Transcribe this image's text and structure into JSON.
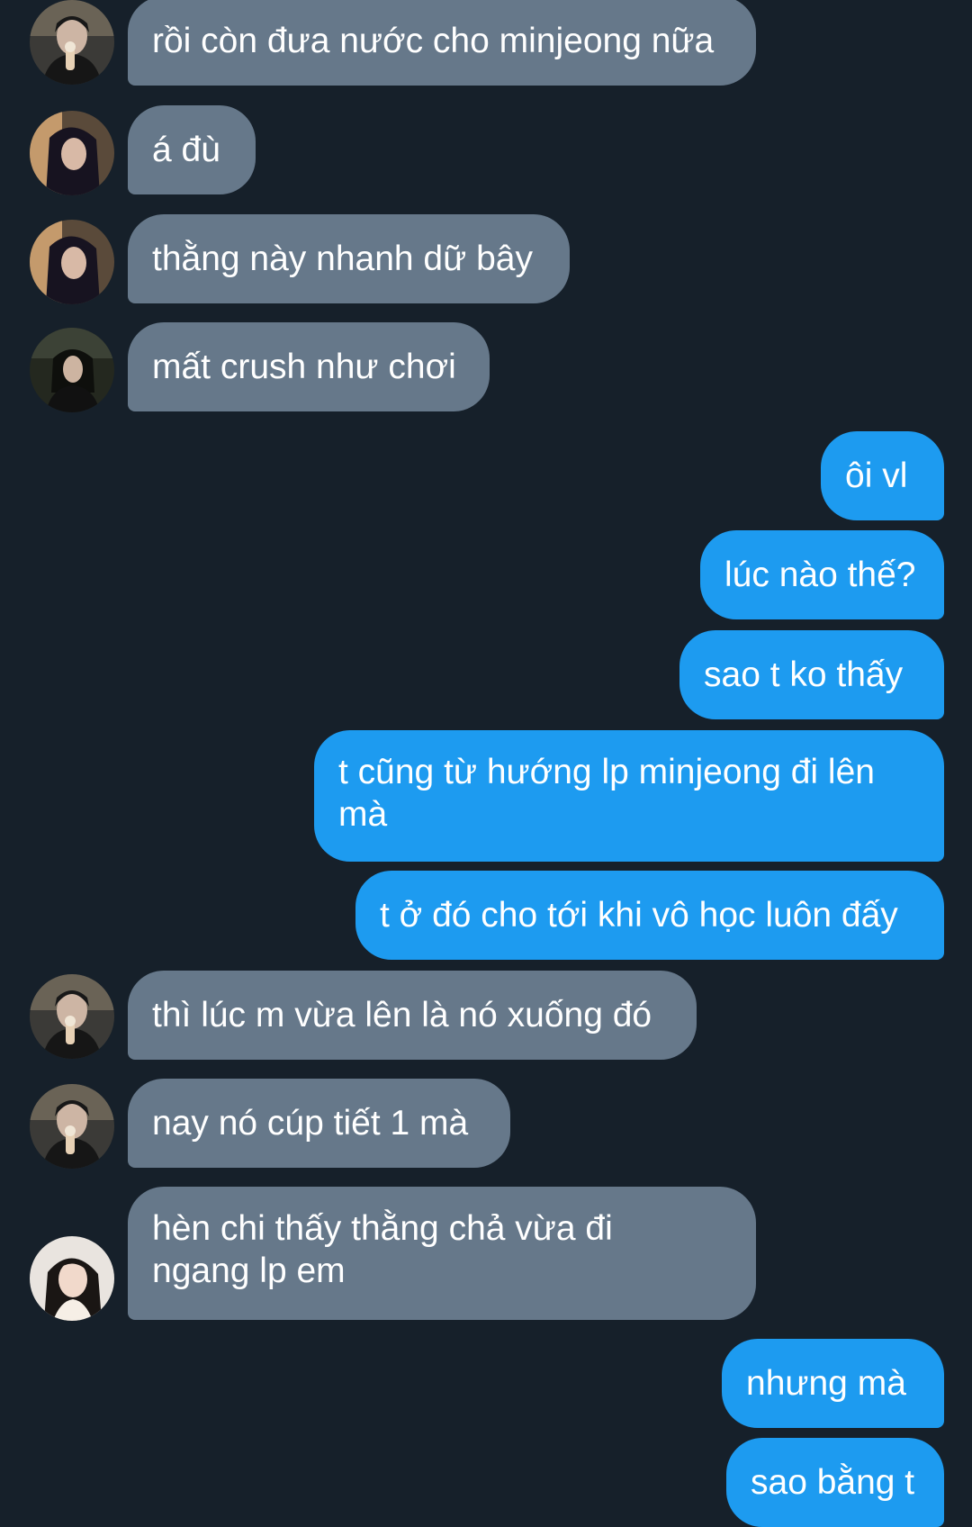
{
  "messages": [
    {
      "sender": "contact-a",
      "text": "rồi còn đưa nước cho minjeong nữa"
    },
    {
      "sender": "contact-b",
      "text": "á đù"
    },
    {
      "sender": "contact-b",
      "text": "thằng này nhanh dữ bây"
    },
    {
      "sender": "contact-c",
      "text": "mất crush như chơi"
    },
    {
      "sender": "me",
      "text": "ôi vl"
    },
    {
      "sender": "me",
      "text": "lúc nào thế?"
    },
    {
      "sender": "me",
      "text": "sao t ko thấy"
    },
    {
      "sender": "me",
      "text": "t cũng từ hướng lp minjeong đi lên\nmà"
    },
    {
      "sender": "me",
      "text": "t ở đó cho tới khi vô học luôn đấy"
    },
    {
      "sender": "contact-a",
      "text": "thì lúc m vừa lên là nó xuống đó"
    },
    {
      "sender": "contact-a",
      "text": "nay nó cúp tiết 1 mà"
    },
    {
      "sender": "contact-d",
      "text": "hèn chi thấy thằng chả vừa đi\nngang lp em"
    },
    {
      "sender": "me",
      "text": "nhưng mà"
    },
    {
      "sender": "me",
      "text": "sao bằng t"
    }
  ],
  "colors": {
    "background": "#16202a",
    "incoming_bubble": "#66788a",
    "outgoing_bubble": "#1d9bf0",
    "text": "#ffffff"
  }
}
